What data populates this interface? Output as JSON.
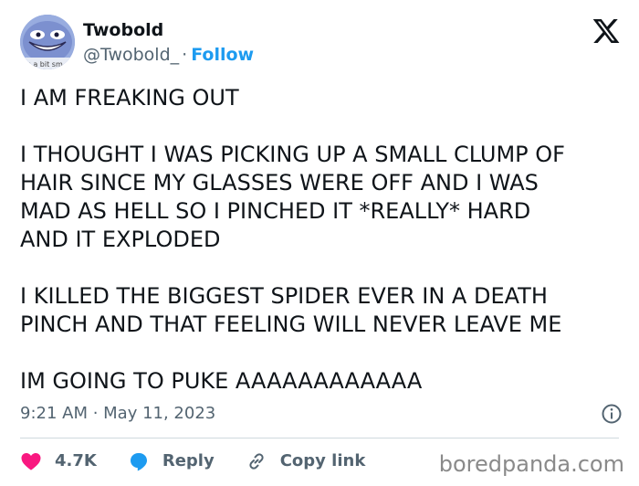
{
  "header": {
    "display_name": "Twobold",
    "handle": "@Twobold_",
    "separator": "·",
    "follow_label": "Follow",
    "avatar_caption": "ks a bit sm"
  },
  "tweet": {
    "paragraphs": [
      "I AM FREAKING OUT",
      "I THOUGHT I WAS PICKING UP A SMALL CLUMP OF\nHAIR SINCE MY GLASSES WERE OFF AND I WAS\nMAD AS HELL SO I PINCHED IT *REALLY* HARD\nAND IT EXPLODED",
      "I KILLED THE BIGGEST SPIDER EVER IN A DEATH\nPINCH AND THAT FEELING WILL NEVER LEAVE ME",
      "IM GOING TO PUKE AAAAAAAAAAAA"
    ],
    "timestamp": "9:21 AM · May 11, 2023"
  },
  "actions": {
    "likes": "4.7K",
    "reply_label": "Reply",
    "copy_link_label": "Copy link"
  },
  "watermark": "boredpanda.com",
  "colors": {
    "accent": "#1d9bf0",
    "like": "#f91880",
    "text": "#0f1419",
    "muted": "#536471"
  }
}
